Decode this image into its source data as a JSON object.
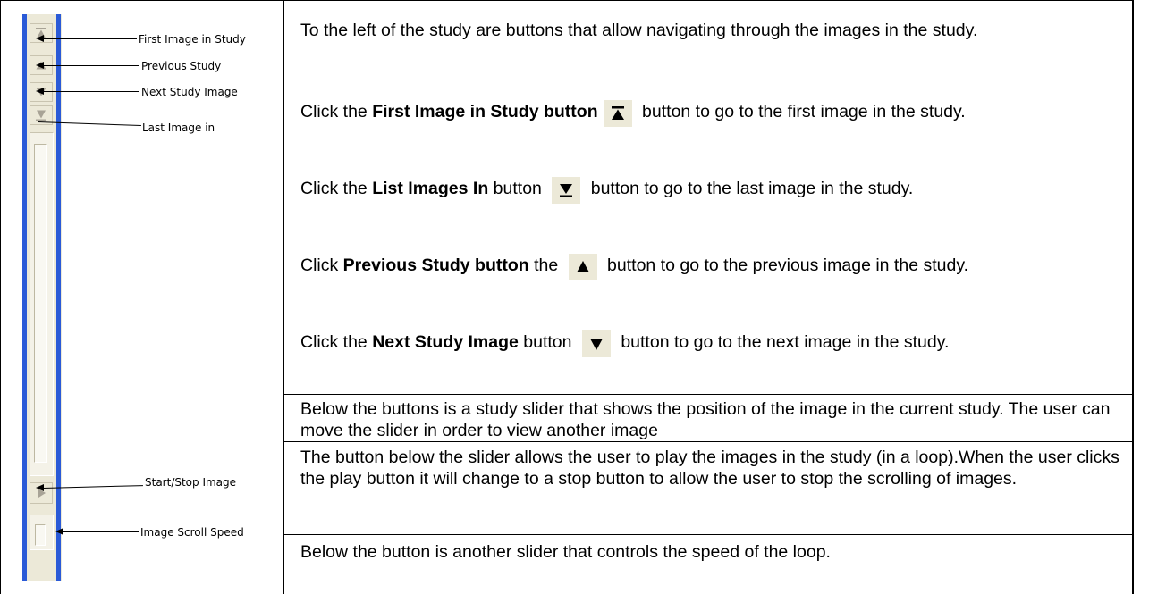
{
  "left_panel": {
    "callouts": [
      "First Image in Study",
      "Previous Study",
      "Next Study Image",
      "Last Image in",
      "Start/Stop Image",
      "Image Scroll Speed"
    ]
  },
  "rows": [
    {
      "text": "To the left of the study are buttons that allow navigating through the images in the study."
    },
    {
      "pre": "Click the ",
      "bold": "First Image in Study button",
      "post": " button to go to the first image in the study.",
      "icon": "first-image-icon"
    },
    {
      "pre": "Click the ",
      "bold": "List Images In",
      "mid": " button ",
      "post": " button to go to the last image in the study.",
      "icon": "last-image-icon"
    },
    {
      "pre": "Click ",
      "bold": "Previous Study button",
      "mid": " the ",
      "post": " button to go to the previous image in the study.",
      "icon": "previous-image-icon"
    },
    {
      "pre": "Click the ",
      "bold": "Next Study Image",
      "mid": " button ",
      "post": " button to go to the next image in the study.",
      "icon": "next-image-icon"
    },
    {
      "text": "Below the buttons is a study slider that shows the position of the image in the current study. The user can move the slider in order to view another image"
    },
    {
      "text": "The button below the slider allows the user to play the images in the study (in a loop).When the user clicks the play button it will change to a stop button to allow the user to stop the scrolling of images."
    },
    {
      "text": "Below the button is another slider that controls the speed of the loop."
    }
  ]
}
